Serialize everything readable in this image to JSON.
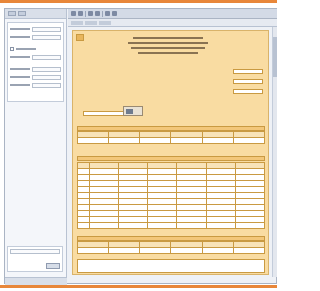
{
  "app": {
    "accent_color": "#e8873a",
    "window_color": "#eef1f6",
    "sheet_color": "#f9dca2"
  },
  "sidebar": {
    "rows": [
      "",
      "",
      "",
      "",
      "",
      "",
      ""
    ],
    "bottom_button_label": ""
  },
  "toolbar": {
    "icons": [
      "back-icon",
      "forward-icon",
      "print-icon",
      "save-icon",
      "zoom-icon",
      "page-icon"
    ]
  },
  "form": {
    "rows": [
      "",
      "",
      "",
      "",
      "",
      "",
      "",
      "",
      "",
      ""
    ]
  }
}
